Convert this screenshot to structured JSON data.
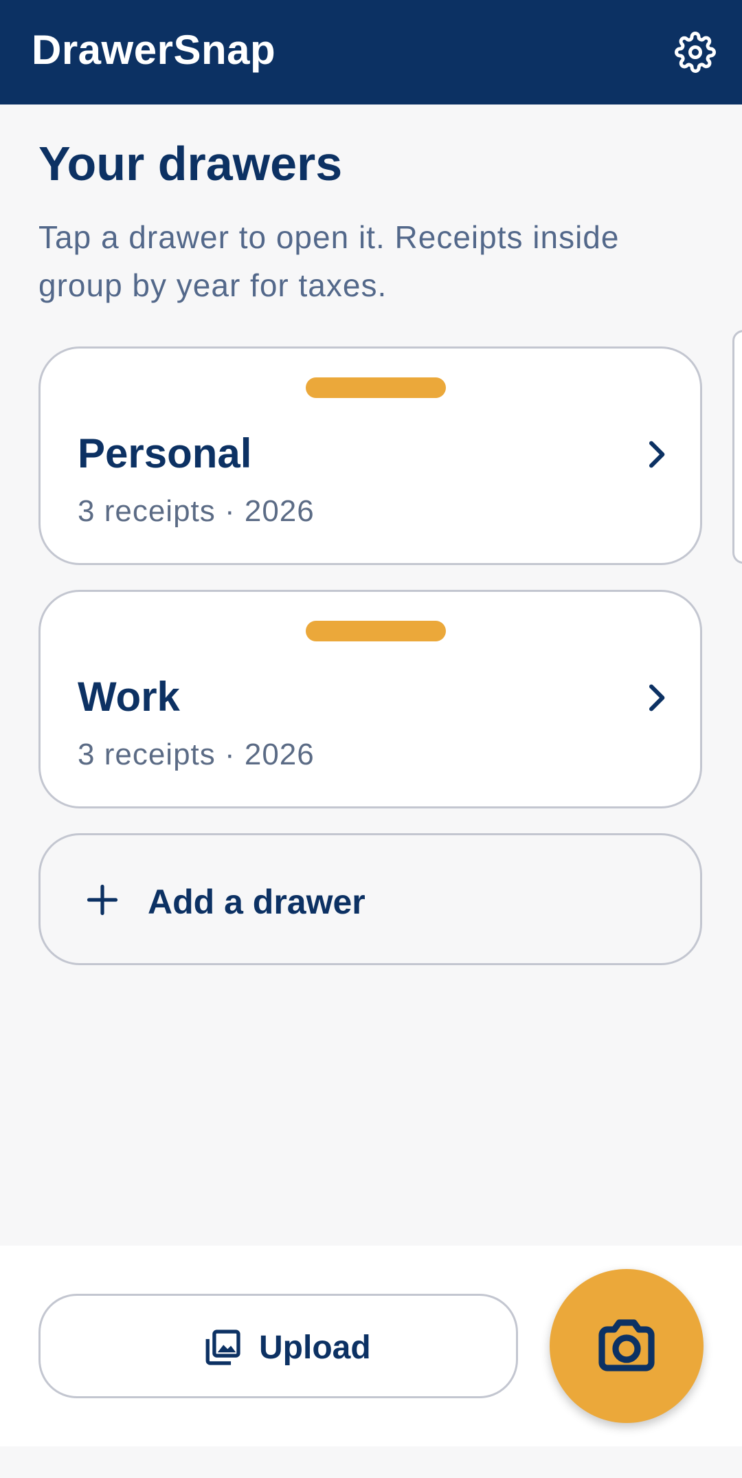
{
  "app": {
    "title": "DrawerSnap",
    "colors": {
      "primary": "#0c3163",
      "accent": "#eba83a",
      "background": "#f7f7f8",
      "muted_text": "#53688a"
    }
  },
  "header": {
    "settings_icon": "gear-icon"
  },
  "main": {
    "title": "Your drawers",
    "subtitle": "Tap a drawer to open it. Receipts inside group by year for taxes.",
    "drawers": [
      {
        "name": "Personal",
        "meta": "3 receipts · 2026",
        "icon": "chevron-right-icon"
      },
      {
        "name": "Work",
        "meta": "3 receipts · 2026",
        "icon": "chevron-right-icon"
      }
    ],
    "add_drawer": {
      "label": "Add a drawer",
      "icon": "plus-icon"
    }
  },
  "bottom_bar": {
    "upload": {
      "label": "Upload",
      "icon": "image-gallery-icon"
    },
    "camera": {
      "icon": "camera-icon"
    }
  }
}
